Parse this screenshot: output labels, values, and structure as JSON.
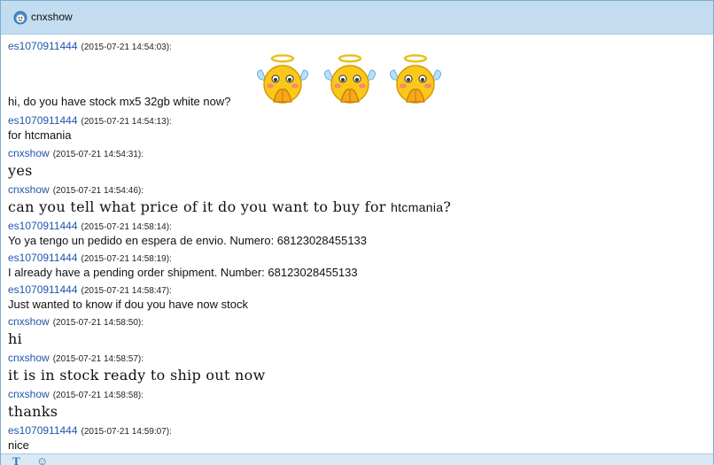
{
  "window": {
    "title": "cnxshow"
  },
  "messages": [
    {
      "sender": "es1070911444",
      "timestamp": "(2015-07-21 14:54:03):",
      "text": "hi, do you have stock mx5 32gb white now?",
      "style": "sans",
      "emoticons": [
        "angel-emoticon",
        "angel-emoticon",
        "angel-emoticon"
      ]
    },
    {
      "sender": "es1070911444",
      "timestamp": "(2015-07-21 14:54:13):",
      "text": "for htcmania",
      "style": "sans"
    },
    {
      "sender": "cnxshow",
      "timestamp": "(2015-07-21 14:54:31):",
      "text": "yes",
      "style": "mono"
    },
    {
      "sender": "cnxshow",
      "timestamp": "(2015-07-21 14:54:46):",
      "text": "can you tell what price of it do you want to buy for",
      "text_tail": "htcmania",
      "text_end": "?",
      "style": "mono"
    },
    {
      "sender": "es1070911444",
      "timestamp": "(2015-07-21 14:58:14):",
      "text": "Yo ya tengo un pedido en espera de envio. Numero: 68123028455133",
      "style": "sans"
    },
    {
      "sender": "es1070911444",
      "timestamp": "(2015-07-21 14:58:19):",
      "text": "I already have a pending order shipment. Number: 68123028455133",
      "style": "sans"
    },
    {
      "sender": "es1070911444",
      "timestamp": "(2015-07-21 14:58:47):",
      "text": "Just wanted to know if dou you have now stock",
      "style": "sans"
    },
    {
      "sender": "cnxshow",
      "timestamp": "(2015-07-21 14:58:50):",
      "text": "hi",
      "style": "mono"
    },
    {
      "sender": "cnxshow",
      "timestamp": "(2015-07-21 14:58:57):",
      "text": "it is in stock ready to ship out now",
      "style": "mono"
    },
    {
      "sender": "cnxshow",
      "timestamp": "(2015-07-21 14:58:58):",
      "text": "thanks",
      "style": "mono"
    },
    {
      "sender": "es1070911444",
      "timestamp": "(2015-07-21 14:59:07):",
      "text": "nice",
      "style": "sans"
    }
  ],
  "toolbar": {
    "font_icon": "text-format-icon",
    "emoji_icon": "smiley-icon",
    "font_glyph": "T",
    "emoji_glyph": "☺"
  },
  "colors": {
    "titlebar": "#c3dcf0",
    "sender": "#2255aa",
    "accent": "#2d74b5"
  }
}
